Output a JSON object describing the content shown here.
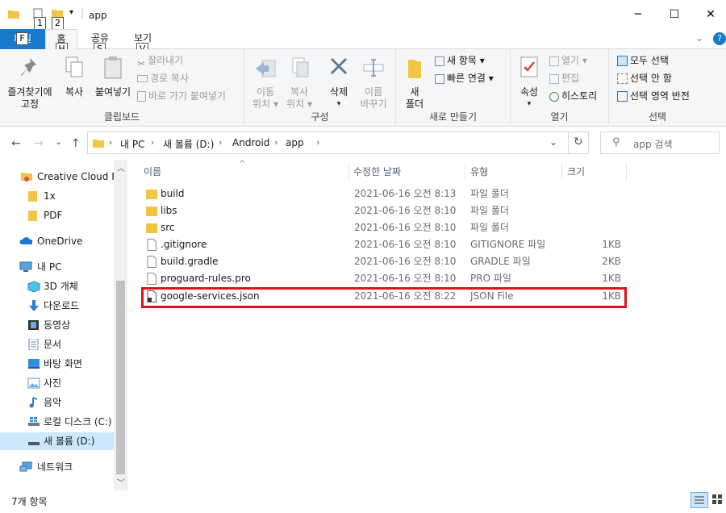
{
  "window": {
    "title": "app",
    "keytips": [
      "1",
      "2"
    ],
    "minimize_glyph": "─",
    "maximize_glyph": "☐",
    "close_glyph": "✕"
  },
  "ribbon_tabs": {
    "file": "파일",
    "file_keytip": "F",
    "home": "홈",
    "home_keytip": "H",
    "share": "공유",
    "share_keytip": "S",
    "view": "보기",
    "view_keytip": "V",
    "help_glyph": "?"
  },
  "ribbon": {
    "clipboard": {
      "pin_line1": "즐겨찾기에",
      "pin_line2": "고정",
      "copy": "복사",
      "paste": "붙여넣기",
      "cut": "잘라내기",
      "copy_path": "경로 복사",
      "paste_shortcut": "바로 가기 붙여넣기",
      "label": "클립보드"
    },
    "organize": {
      "move_line1": "이동",
      "move_line2": "위치",
      "copyto_line1": "복사",
      "copyto_line2": "위치",
      "delete": "삭제",
      "rename_line1": "이름",
      "rename_line2": "바꾸기",
      "label": "구성"
    },
    "new": {
      "newfolder_line1": "새",
      "newfolder_line2": "폴더",
      "new_item": "새 항목",
      "easy_access": "빠른 연결",
      "label": "새로 만들기"
    },
    "open": {
      "properties": "속성",
      "open": "열기",
      "edit": "편집",
      "history": "히스토리",
      "label": "열기"
    },
    "select": {
      "select_all": "모두 선택",
      "select_none": "선택 안 함",
      "invert": "선택 영역 반전",
      "label": "선택"
    }
  },
  "address": {
    "crumbs": [
      "내 PC",
      "새 볼륨 (D:)",
      "Android",
      "app"
    ],
    "search_placeholder": "app 검색",
    "back_glyph": "←",
    "forward_glyph": "→",
    "recent_glyph": "⌄",
    "up_glyph": "↑",
    "dropdown_glyph": "⌄",
    "refresh_glyph": "↻",
    "search_glyph": "⚲",
    "separator_glyph": "›"
  },
  "nav": {
    "items": [
      {
        "label": "Creative Cloud Fil"
      },
      {
        "label": "1x"
      },
      {
        "label": "PDF"
      },
      {
        "label": "OneDrive"
      },
      {
        "label": "내 PC"
      },
      {
        "label": "3D 개체"
      },
      {
        "label": "다운로드"
      },
      {
        "label": "동영상"
      },
      {
        "label": "문서"
      },
      {
        "label": "바탕 화면"
      },
      {
        "label": "사진"
      },
      {
        "label": "음악"
      },
      {
        "label": "로컬 디스크 (C:)"
      },
      {
        "label": "새 볼륨 (D:)"
      },
      {
        "label": "네트워크"
      }
    ]
  },
  "columns": {
    "name": "이름",
    "date": "수정한 날짜",
    "type": "유형",
    "size": "크기"
  },
  "files": [
    {
      "name": "build",
      "date": "2021-06-16 오전 8:13",
      "type": "파일 폴더",
      "size": ""
    },
    {
      "name": "libs",
      "date": "2021-06-16 오전 8:10",
      "type": "파일 폴더",
      "size": ""
    },
    {
      "name": "src",
      "date": "2021-06-16 오전 8:10",
      "type": "파일 폴더",
      "size": ""
    },
    {
      "name": ".gitignore",
      "date": "2021-06-16 오전 8:10",
      "type": "GITIGNORE 파일",
      "size": "1KB"
    },
    {
      "name": "build.gradle",
      "date": "2021-06-16 오전 8:10",
      "type": "GRADLE 파일",
      "size": "2KB"
    },
    {
      "name": "proguard-rules.pro",
      "date": "2021-06-16 오전 8:10",
      "type": "PRO 파일",
      "size": "1KB"
    },
    {
      "name": "google-services.json",
      "date": "2021-06-16 오전 8:22",
      "type": "JSON File",
      "size": "1KB"
    }
  ],
  "status": {
    "item_count": "7개 항목"
  },
  "colors": {
    "accent": "#1979ca",
    "folder": "#f3c545",
    "highlight": "#e0101f",
    "selection": "#cce8ff"
  }
}
